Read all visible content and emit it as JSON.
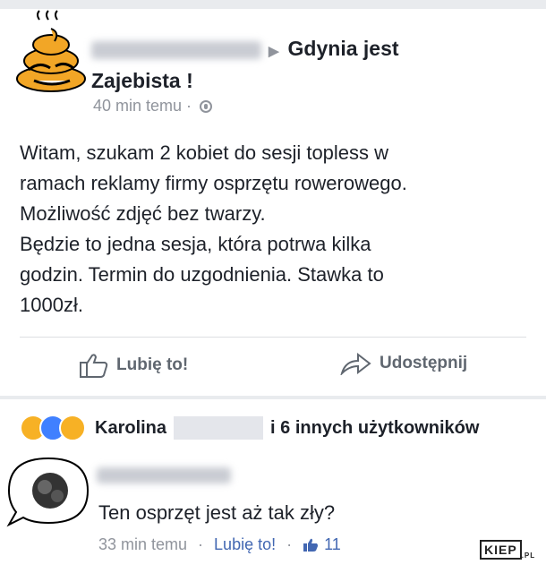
{
  "post": {
    "author_prefix": "▶",
    "target_group": "Gdynia jest",
    "target_group_2": "Zajebista !",
    "time": "40 min temu",
    "body_lines": [
      "Witam, szukam 2 kobiet do sesji topless w",
      "ramach reklamy firmy osprzętu rowerowego.",
      "Możliwość zdjęć bez twarzy.",
      "Będzie to jedna sesja, która potrwa kilka",
      "godzin. Termin do uzgodnienia. Stawka to",
      "1000zł."
    ]
  },
  "actions": {
    "like": "Lubię to!",
    "share": "Udostępnij"
  },
  "reactions": {
    "name": "Karolina",
    "others": "i 6 innych użytkowników"
  },
  "comment": {
    "text": "Ten osprzęt jest aż tak zły?",
    "time": "33 min temu",
    "like": "Lubię to!",
    "likes_count": "11"
  },
  "watermark": {
    "text": "KIEP",
    "suffix": ".PL"
  },
  "colors": {
    "link": "#4267b2",
    "muted": "#90949c",
    "text": "#1d2129"
  }
}
